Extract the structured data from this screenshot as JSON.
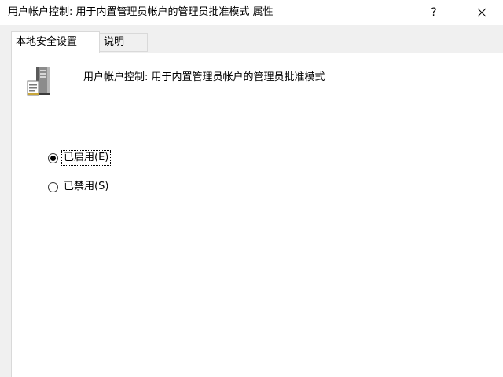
{
  "window": {
    "title": "用户帐户控制: 用于内置管理员帐户的管理员批准模式 属性",
    "help_label": "?",
    "close_icon": "close-icon"
  },
  "tabs": [
    {
      "label": "本地安全设置",
      "active": true
    },
    {
      "label": "说明",
      "active": false
    }
  ],
  "policy": {
    "icon": "server-policy-icon",
    "name": "用户帐户控制: 用于内置管理员帐户的管理员批准模式"
  },
  "options": [
    {
      "label": "已启用(E)",
      "checked": true
    },
    {
      "label": "已禁用(S)",
      "checked": false
    }
  ]
}
